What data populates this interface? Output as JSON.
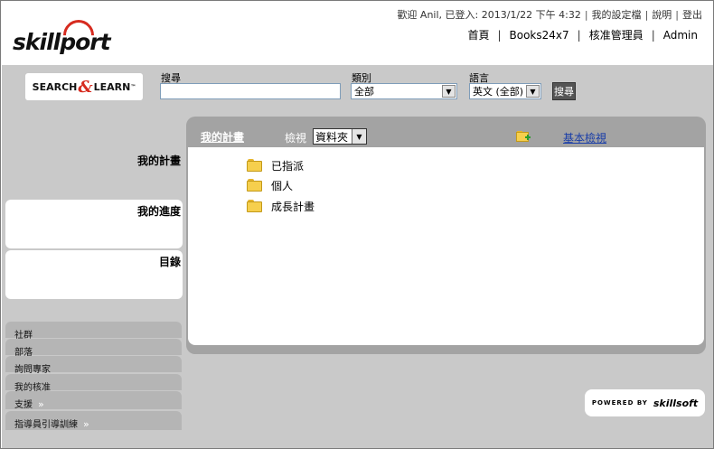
{
  "header": {
    "logo_text": "skillport",
    "welcome": "歡迎 Anil, 已登入: 2013/1/22 下午 4:32",
    "links": [
      "我的設定檔",
      "說明",
      "登出"
    ],
    "nav": [
      "首頁",
      "Books24x7",
      "核准管理員",
      "Admin"
    ]
  },
  "search": {
    "logo_text": "SEARCH & LEARN",
    "logo_search": "SEARCH",
    "logo_amp": "&",
    "logo_learn": "LEARN",
    "logo_tm": "™",
    "search_label": "搜尋",
    "search_value": "",
    "category_label": "類別",
    "category_value": "全部",
    "language_label": "語言",
    "language_value": "英文 (全部)",
    "button_label": "搜尋"
  },
  "sidebar": {
    "sections": [
      "我的計畫",
      "我的進度",
      "目錄"
    ],
    "links": [
      {
        "label": "社群",
        "chevron": ""
      },
      {
        "label": "部落",
        "chevron": ""
      },
      {
        "label": "詢問專家",
        "chevron": ""
      },
      {
        "label": "我的核准",
        "chevron": ""
      },
      {
        "label": "支援",
        "chevron": "»"
      },
      {
        "label": "指導員引導訓練",
        "chevron": "»"
      }
    ]
  },
  "panel": {
    "title": "我的計畫",
    "view_label": "檢視",
    "view_value": "資料夾",
    "basic_view_link": "基本檢視",
    "folders": [
      "已指派",
      "個人",
      "成長計畫"
    ]
  },
  "footer": {
    "powered_by": "POWERED BY",
    "brand": "skillsoft"
  },
  "colors": {
    "accent": "#d62b1f",
    "band": "#c9c9c9",
    "panel": "#a3a3a3",
    "link": "#1a3ea8"
  }
}
